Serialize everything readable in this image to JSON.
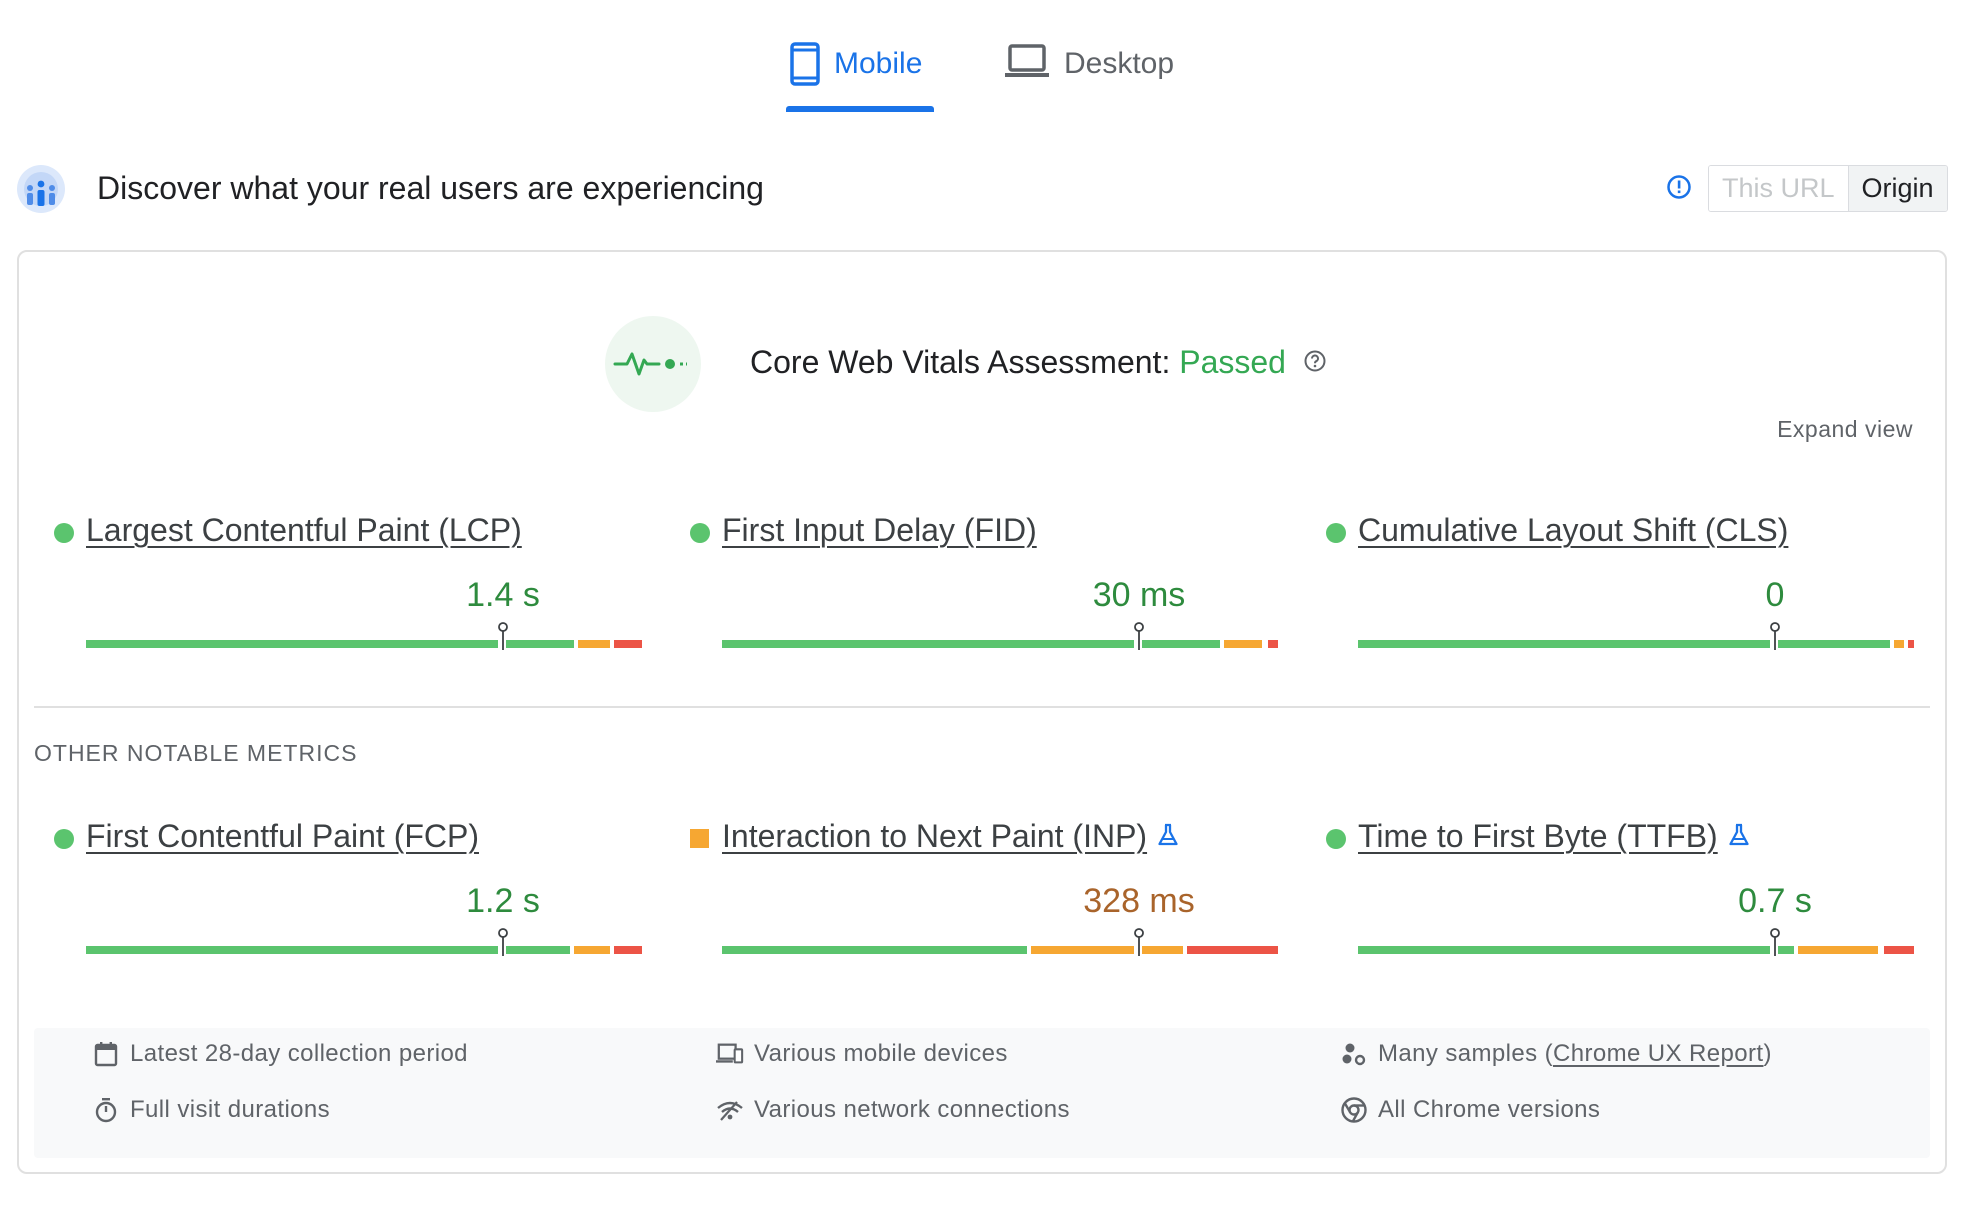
{
  "tabs": {
    "mobile": {
      "label": "Mobile",
      "icon": "smartphone-icon",
      "active": true
    },
    "desktop": {
      "label": "Desktop",
      "icon": "laptop-icon",
      "active": false
    }
  },
  "header": {
    "title": "Discover what your real users are experiencing",
    "icon": "real-users-icon",
    "info_icon": "info-icon",
    "toggle": {
      "this_url": "This URL",
      "origin": "Origin",
      "selected": "Origin"
    }
  },
  "assessment": {
    "label": "Core Web Vitals Assessment:",
    "status": "Passed",
    "help_icon": "help-icon",
    "expand_label": "Expand view"
  },
  "core_metrics": [
    {
      "name": "Largest Contentful Paint (LCP)",
      "value": "1.4 s",
      "rating": "good",
      "marker_fraction": 0.75,
      "experimental": false
    },
    {
      "name": "First Input Delay (FID)",
      "value": "30 ms",
      "rating": "good",
      "marker_fraction": 0.75,
      "experimental": false
    },
    {
      "name": "Cumulative Layout Shift (CLS)",
      "value": "0",
      "rating": "good",
      "marker_fraction": 0.75,
      "experimental": false
    }
  ],
  "other_title": "OTHER NOTABLE METRICS",
  "other_metrics": [
    {
      "name": "First Contentful Paint (FCP)",
      "value": "1.2 s",
      "rating": "good",
      "marker_fraction": 0.75,
      "experimental": false
    },
    {
      "name": "Interaction to Next Paint (INP)",
      "value": "328 ms",
      "rating": "needs-improvement",
      "marker_fraction": 0.75,
      "experimental": true
    },
    {
      "name": "Time to First Byte (TTFB)",
      "value": "0.7 s",
      "rating": "good",
      "marker_fraction": 0.75,
      "experimental": true
    }
  ],
  "footer": {
    "collection_period": "Latest 28-day collection period",
    "visit_durations": "Full visit durations",
    "devices": "Various mobile devices",
    "network": "Various network connections",
    "samples_prefix": "Many samples (",
    "samples_link": "Chrome UX Report",
    "samples_suffix": ")",
    "chrome_versions": "All Chrome versions"
  },
  "colors": {
    "accent": "#1a73e8",
    "good": "#5bc46e",
    "needs_improvement": "#f6a732",
    "poor": "#ec5446",
    "passed_text": "#34a853"
  }
}
